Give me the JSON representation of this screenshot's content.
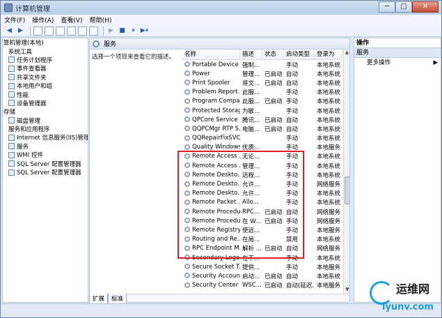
{
  "window": {
    "title": "计算机管理",
    "min": "─",
    "max": "□",
    "close": "✕"
  },
  "menu": [
    "文件(F)",
    "操作(A)",
    "查看(V)",
    "帮助(H)"
  ],
  "toolbar": {
    "back": "◀",
    "forward": "▶",
    "play": "▶",
    "stop": "■",
    "pause": "⏸",
    "restart": "▶⏸"
  },
  "tree": [
    "算机管理(本地)",
    "系统工具",
    "任务计划程序",
    "事件查看器",
    "共享文件夹",
    "本地用户和组",
    "性能",
    "设备管理器",
    "存储",
    "磁盘管理",
    "服务和应用程序",
    "Internet 信息服务(IIS)管理器",
    "服务",
    "WMI 控件",
    "SQL Server 配置管理器",
    "SQL Server 配置管理器"
  ],
  "center": {
    "header": "服务",
    "description": "选择一个项目来查看它的描述。",
    "columns": [
      "名称",
      "描述",
      "状态",
      "启动类型",
      "登录为"
    ],
    "rows": [
      [
        "Portable Device ...",
        "强制...",
        "",
        "手动",
        "本地系统"
      ],
      [
        "Power",
        "管理...",
        "已启动",
        "自动",
        "本地系统"
      ],
      [
        "Print Spooler",
        "将文...",
        "已启动",
        "自动",
        "本地系统"
      ],
      [
        "Problem Report...",
        "此服...",
        "",
        "手动",
        "本地系统"
      ],
      [
        "Program Compa...",
        "此服...",
        "已启动",
        "手动",
        "本地系统"
      ],
      [
        "Protected Storage",
        "为敏...",
        "",
        "手动",
        "本地系统"
      ],
      [
        "QPCore Service",
        "腾讯...",
        "已启动",
        "自动",
        "本地系统"
      ],
      [
        "QQPCMgr RTP S...",
        "电脑...",
        "已启动",
        "自动",
        "本地系统"
      ],
      [
        "QQRepairFixSVC",
        "",
        "",
        "手动",
        "本地系统"
      ],
      [
        "Quality Windows...",
        "优质...",
        "",
        "手动",
        "本地服务"
      ],
      [
        "Remote Access ...",
        "无论...",
        "",
        "手动",
        "本地系统"
      ],
      [
        "Remote Access ...",
        "管理...",
        "",
        "手动",
        "本地系统"
      ],
      [
        "Remote Deskto...",
        "远程...",
        "",
        "手动",
        "本地系统"
      ],
      [
        "Remote Deskto...",
        "允许...",
        "",
        "手动",
        "网络服务"
      ],
      [
        "Remote Deskto...",
        "允许...",
        "",
        "手动",
        "本地系统"
      ],
      [
        "Remote Packet ...",
        "Allo...",
        "",
        "手动",
        "本地系统"
      ],
      [
        "Remote Procedu...",
        "RPC...",
        "已启动",
        "自动",
        "网络服务"
      ],
      [
        "Remote Procedu...",
        "在 W...",
        "已启动",
        "手动",
        "网络服务"
      ],
      [
        "Remote Registry",
        "使远...",
        "",
        "手动",
        "本地服务"
      ],
      [
        "Routing and Re...",
        "在局...",
        "",
        "禁用",
        "本地系统"
      ],
      [
        "RPC Endpoint M...",
        "解析 ...",
        "已启动",
        "自动",
        "网络服务"
      ],
      [
        "Secondary Logon",
        "在不...",
        "",
        "手动",
        "本地系统"
      ],
      [
        "Secure Socket T...",
        "提供...",
        "",
        "手动",
        "本地服务"
      ],
      [
        "Security Accoun...",
        "启动...",
        "已启动",
        "自动",
        "本地系统"
      ],
      [
        "Security Center",
        "WSC...",
        "已启动",
        "自动(延迟...",
        "本地服务"
      ]
    ]
  },
  "tabs": [
    "扩展",
    "标准"
  ],
  "actions": {
    "title": "操作",
    "section": "服务",
    "more": "更多操作",
    "arrow": "▶"
  },
  "watermark": {
    "name": "运维网",
    "url": "iyunv.com"
  }
}
